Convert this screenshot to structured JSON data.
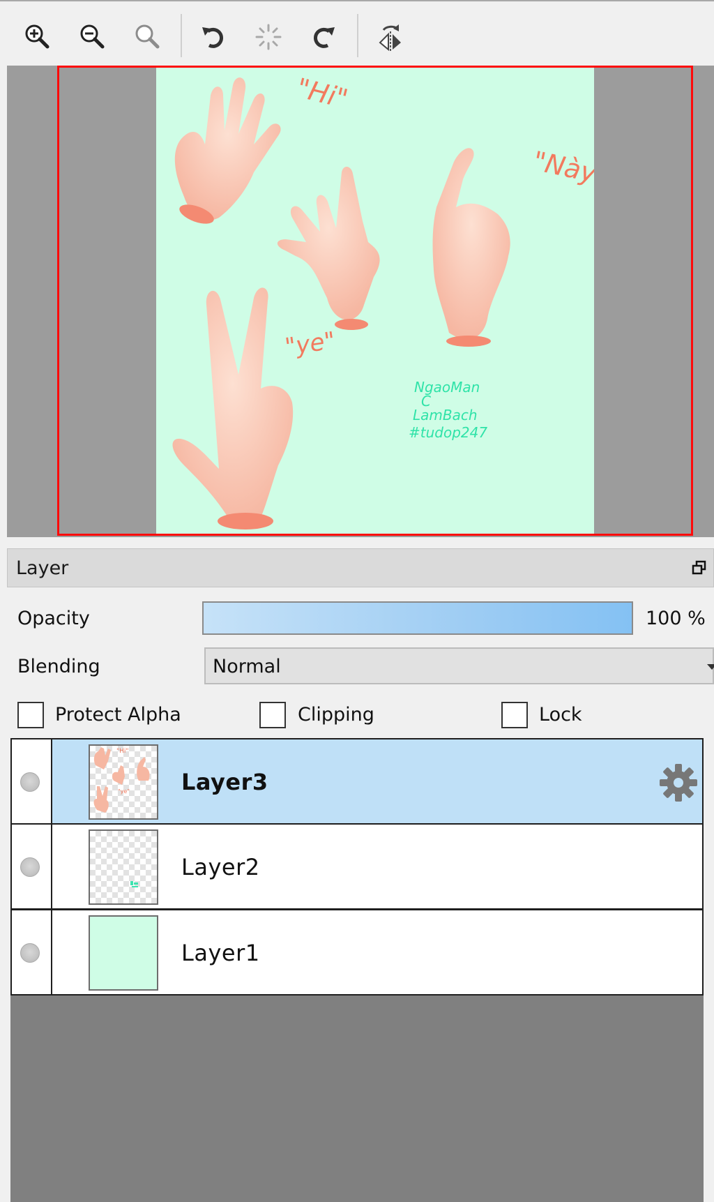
{
  "toolbar": {
    "icons": [
      "zoom-in-icon",
      "zoom-out-icon",
      "zoom-reset-icon",
      "rotate-left-icon",
      "rotate-reset-icon",
      "rotate-right-icon",
      "flip-horizontal-icon"
    ]
  },
  "navigator": {
    "canvas_background": "#cffde6",
    "frame_color": "#ff0a0a",
    "artwork_text": {
      "hi": "\"Hi\"",
      "nay": "\"Này\"",
      "ye": "\"ye\"",
      "signature_line1": "NgaoMan",
      "signature_line2": "C",
      "signature_line3": "LamBach",
      "signature_line4": "#tudop247"
    }
  },
  "layer_panel": {
    "title": "Layer",
    "opacity_label": "Opacity",
    "opacity_value": "100 %",
    "opacity_fraction": 1.0,
    "blending_label": "Blending",
    "blending_value": "Normal",
    "protect_alpha_label": "Protect Alpha",
    "clipping_label": "Clipping",
    "lock_label": "Lock",
    "protect_alpha_checked": false,
    "clipping_checked": false,
    "lock_checked": false
  },
  "layers": [
    {
      "name": "Layer3",
      "selected": true
    },
    {
      "name": "Layer2",
      "selected": false
    },
    {
      "name": "Layer1",
      "selected": false
    }
  ],
  "colors": {
    "selection": "#bfe0f7",
    "opacity_bar": "#84c1f3",
    "skin": "#fbd2c0",
    "lettering": "#f27a5e",
    "signature": "#2fe3a8"
  }
}
